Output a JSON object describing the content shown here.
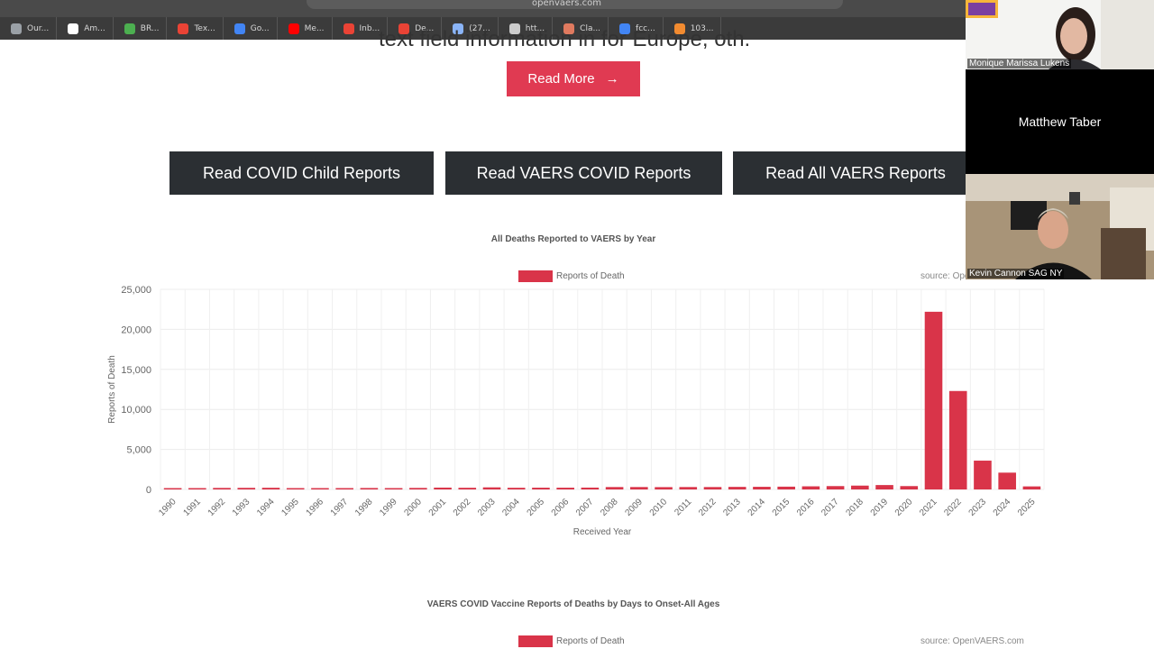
{
  "browser": {
    "url": "openvaers.com",
    "bookmarks": [
      {
        "label": "Our...",
        "icon": "globe-icon",
        "color": "#9aa0a6"
      },
      {
        "label": "Am...",
        "icon": "amazon-icon",
        "color": "#ffffff"
      },
      {
        "label": "BR...",
        "icon": "play-icon",
        "color": "#4caf50"
      },
      {
        "label": "Tex...",
        "icon": "gmail-icon",
        "color": "#ea4335"
      },
      {
        "label": "Go...",
        "icon": "calendar-icon",
        "color": "#4285f4"
      },
      {
        "label": "Me...",
        "icon": "youtube-icon",
        "color": "#ff0000"
      },
      {
        "label": "Inb...",
        "icon": "gmail-icon",
        "color": "#ea4335"
      },
      {
        "label": "De...",
        "icon": "gmail-icon",
        "color": "#ea4335"
      },
      {
        "label": "(27...",
        "icon": "document-icon",
        "color": "#8ab4f8"
      },
      {
        "label": "htt...",
        "icon": "qr-icon",
        "color": "#cccccc"
      },
      {
        "label": "Cla...",
        "icon": "claude-icon",
        "color": "#e07a5f"
      },
      {
        "label": "fcc...",
        "icon": "google-icon",
        "color": "#4285f4"
      },
      {
        "label": "103...",
        "icon": "app-icon",
        "color": "#f28b30"
      }
    ]
  },
  "page": {
    "cutoff_text": "text field information in for Europe, oth.",
    "read_more": "Read More",
    "read_more_arrow": "→",
    "buttons": [
      "Read COVID Child Reports",
      "Read VAERS COVID Reports",
      "Read All VAERS Reports"
    ]
  },
  "chart1": {
    "legend": "Reports of Death",
    "source": "source: OpenVAERS.com"
  },
  "chart_data": [
    {
      "type": "bar",
      "title": "All Deaths Reported to VAERS by Year",
      "xlabel": "Received Year",
      "ylabel": "Reports of Death",
      "ylim": [
        0,
        25000
      ],
      "yticks": [
        "0",
        "5,000",
        "10,000",
        "15,000",
        "20,000",
        "25,000"
      ],
      "ytick_values": [
        0,
        5000,
        10000,
        15000,
        20000,
        25000
      ],
      "categories": [
        "1990",
        "1991",
        "1992",
        "1993",
        "1994",
        "1995",
        "1996",
        "1997",
        "1998",
        "1999",
        "2000",
        "2001",
        "2002",
        "2003",
        "2004",
        "2005",
        "2006",
        "2007",
        "2008",
        "2009",
        "2010",
        "2011",
        "2012",
        "2013",
        "2014",
        "2015",
        "2016",
        "2017",
        "2018",
        "2019",
        "2020",
        "2021",
        "2022",
        "2023",
        "2024",
        "2025"
      ],
      "series": [
        {
          "name": "Reports of Death",
          "color": "#d93449",
          "values": [
            120,
            150,
            190,
            200,
            210,
            150,
            160,
            170,
            180,
            170,
            190,
            230,
            210,
            260,
            210,
            220,
            220,
            230,
            300,
            300,
            290,
            300,
            300,
            320,
            330,
            350,
            390,
            420,
            480,
            550,
            420,
            22200,
            12300,
            3600,
            2100,
            380
          ]
        }
      ],
      "grid": true,
      "legend_position": "top-center"
    },
    {
      "type": "bar",
      "title": "VAERS COVID Vaccine Reports of Deaths by Days to Onset-All Ages",
      "series": [
        {
          "name": "Reports of Death",
          "color": "#d93449",
          "values": []
        }
      ],
      "legend_position": "top-center"
    }
  ],
  "chart2": {
    "legend": "Reports of Death",
    "source": "source: OpenVAERS.com"
  },
  "participants": [
    {
      "name": "Monique Marissa Lukens"
    },
    {
      "name": "Matthew Taber"
    },
    {
      "name": "Kevin Cannon SAG NY"
    }
  ]
}
